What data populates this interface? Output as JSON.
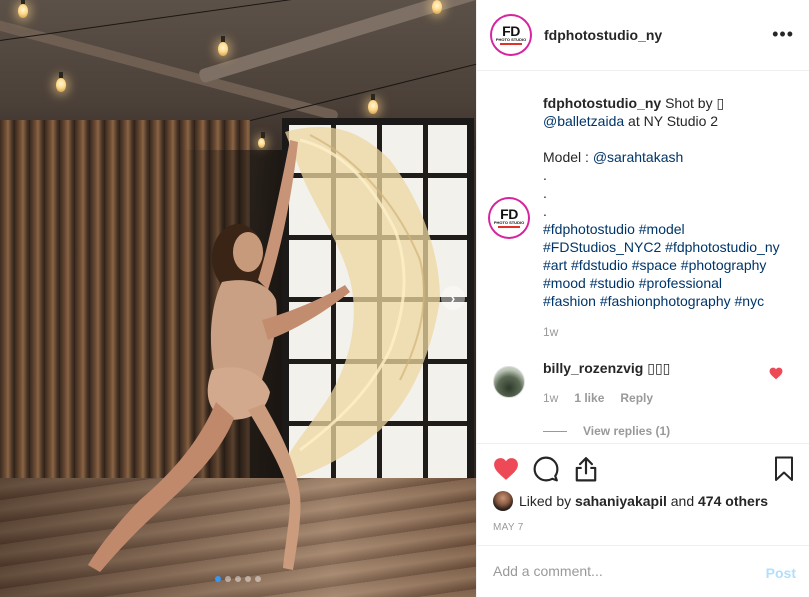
{
  "post": {
    "username": "fdphotostudio_ny",
    "avatar_text": {
      "big": "FD",
      "small": "PHOTO STUDIO"
    },
    "more_label": "•••"
  },
  "caption": {
    "username": "fdphotostudio_ny",
    "text_before": " Shot by ",
    "camera_glyph": "▯",
    "mention1": "@balletzaida",
    "location": " at NY Studio 2",
    "model_label": "Model : ",
    "mention2": "@sarahtakash",
    "dots": [
      ".",
      ".",
      "."
    ],
    "hashtags": [
      [
        "#fdphotostudio",
        "#model"
      ],
      [
        "#FDStudios_NYC2",
        "#fdphotostudio_ny"
      ],
      [
        "#art",
        "#fdstudio",
        "#space",
        "#photography"
      ],
      [
        "#mood",
        "#studio",
        "#professional"
      ],
      [
        "#fashion",
        "#fashionphotography",
        "#nyc"
      ]
    ],
    "age": "1w"
  },
  "comment": {
    "username": "billy_rozenzvig",
    "text": " ▯▯▯",
    "age": "1w",
    "likes": "1 like",
    "reply": "Reply",
    "view_replies": "View replies (1)"
  },
  "actions": {
    "liked_by_prefix": "Liked by ",
    "liked_by_user": "sahaniyakapil",
    "liked_by_suffix": " and ",
    "others": "474 others",
    "date": "MAY 7"
  },
  "add_comment": {
    "placeholder": "Add a comment...",
    "post_label": "Post"
  },
  "carousel": {
    "total": 5,
    "current": 1
  },
  "colors": {
    "like_red": "#ed4956",
    "link_blue": "#003569",
    "dot_active": "#3897f0",
    "post_disabled": "#b2dffc"
  }
}
